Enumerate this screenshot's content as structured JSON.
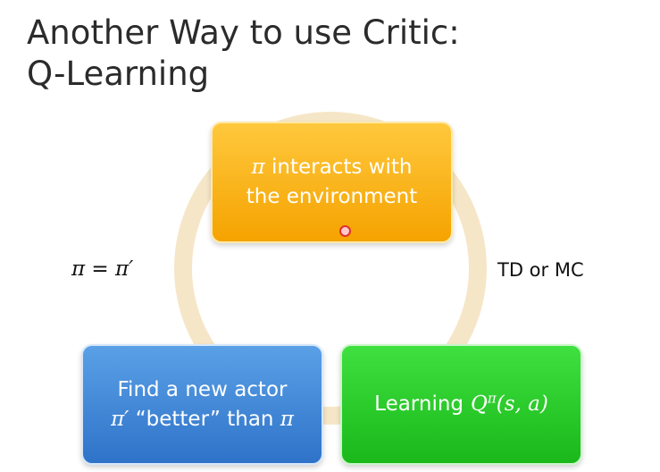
{
  "title": {
    "line1": "Another Way to use Critic:",
    "line2": "Q-Learning"
  },
  "boxes": {
    "top": {
      "pi": "π",
      "line1_rest": " interacts with",
      "line2": "the environment",
      "color": "#f5a300"
    },
    "right": {
      "word": "Learning",
      "q": "Q",
      "q_sup": "π",
      "q_args": "(s, a)",
      "color": "#1ab81a"
    },
    "left": {
      "line1": "Find a new actor",
      "pi_prime": "π′",
      "quote_better": " “better” than ",
      "pi": "π",
      "color": "#2f73c9"
    }
  },
  "edges": {
    "right_label": "TD or MC",
    "left_label": "π = π′"
  },
  "ring_color": "#f6e6c8"
}
